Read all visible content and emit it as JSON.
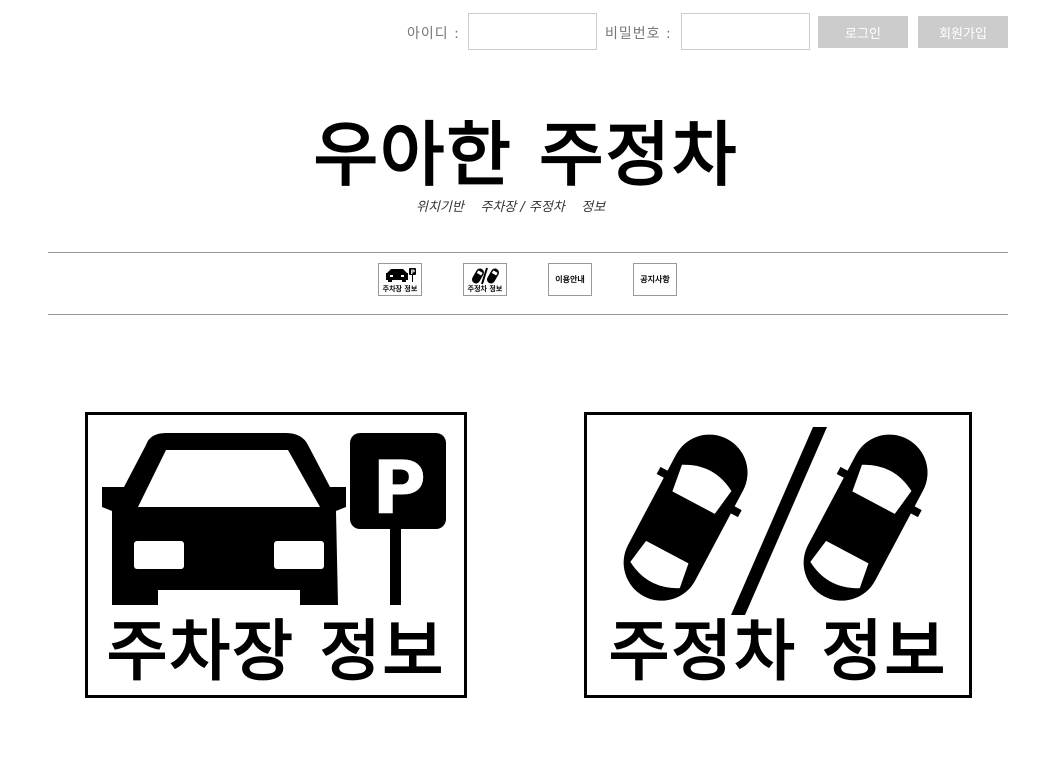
{
  "login": {
    "id_label": "아이디 :",
    "id_value": "",
    "pw_label": "비밀번호 :",
    "pw_value": "",
    "login_button": "로그인",
    "signup_button": "회원가입"
  },
  "logo": {
    "title": "우아한 주정차",
    "subtitle": "위치기반    주차장 / 주정차    정보"
  },
  "nav": {
    "items": [
      {
        "label": "주차장 정보",
        "icon": "car-parking-icon"
      },
      {
        "label": "주정차 정보",
        "icon": "parked-cars-icon"
      },
      {
        "label": "이용안내",
        "icon": ""
      },
      {
        "label": "공지사항",
        "icon": ""
      }
    ]
  },
  "cards": [
    {
      "label": "주차장 정보",
      "icon": "car-parking-icon"
    },
    {
      "label": "주정차 정보",
      "icon": "parked-cars-icon"
    }
  ],
  "colors": {
    "button_bg": "#cccccc",
    "divider": "#999999",
    "ink": "#000000"
  }
}
